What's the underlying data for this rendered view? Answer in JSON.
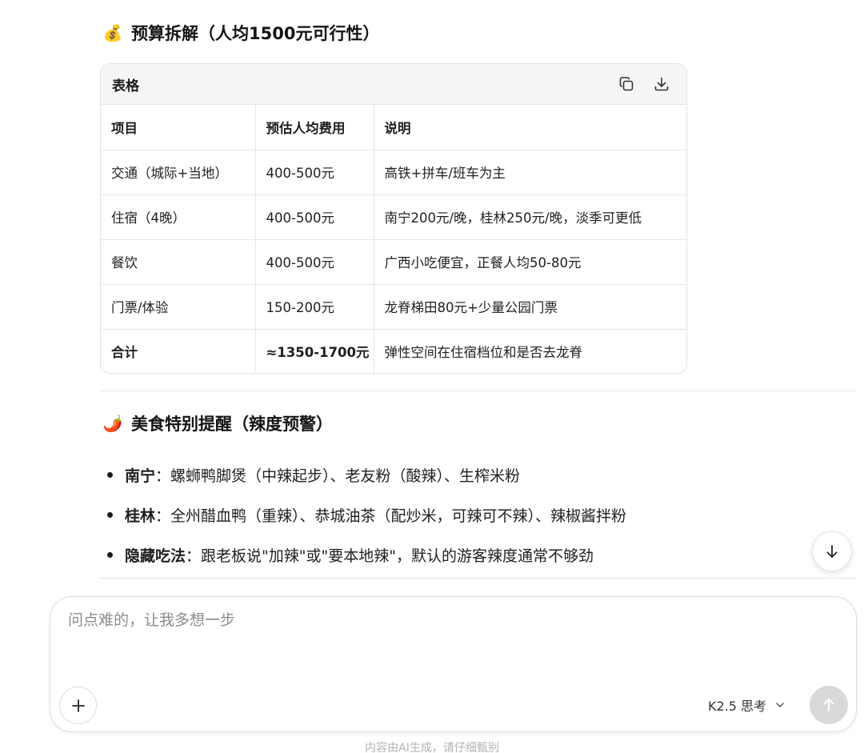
{
  "budget_section": {
    "emoji": "💰",
    "title": "预算拆解（人均1500元可行性）"
  },
  "table": {
    "header_label": "表格",
    "copy_icon": "copy-icon",
    "download_icon": "download-icon",
    "columns": [
      "项目",
      "预估人均费用",
      "说明"
    ],
    "rows": [
      [
        "交通（城际+当地）",
        "400-500元",
        "高铁+拼车/班车为主"
      ],
      [
        "住宿（4晚）",
        "400-500元",
        "南宁200元/晚，桂林250元/晚，淡季可更低"
      ],
      [
        "餐饮",
        "400-500元",
        "广西小吃便宜，正餐人均50-80元"
      ],
      [
        "门票/体验",
        "150-200元",
        "龙脊梯田80元+少量公园门票"
      ],
      [
        "合计",
        "≈1350-1700元",
        "弹性空间在住宿档位和是否去龙脊"
      ]
    ]
  },
  "food_section": {
    "emoji": "🌶️",
    "title": "美食特别提醒（辣度预警）",
    "items": [
      {
        "key": "南宁",
        "text": "：螺蛳鸭脚煲（中辣起步）、老友粉（酸辣）、生榨米粉"
      },
      {
        "key": "桂林",
        "text": "：全州醋血鸭（重辣）、恭城油茶（配炒米，可辣可不辣）、辣椒酱拌粉"
      },
      {
        "key": "隐藏吃法",
        "text": "：跟老板说\"加辣\"或\"要本地辣\"，默认的游客辣度通常不够劲"
      }
    ]
  },
  "composer": {
    "placeholder": "问点难的，让我多想一步",
    "model_label": "K2.5 思考"
  },
  "footer_note": "内容由AI生成，请仔细甄别",
  "colors": {
    "border": "#e3e3e3",
    "header_bg": "#f5f5f5",
    "send_disabled": "#d9d9d9"
  }
}
